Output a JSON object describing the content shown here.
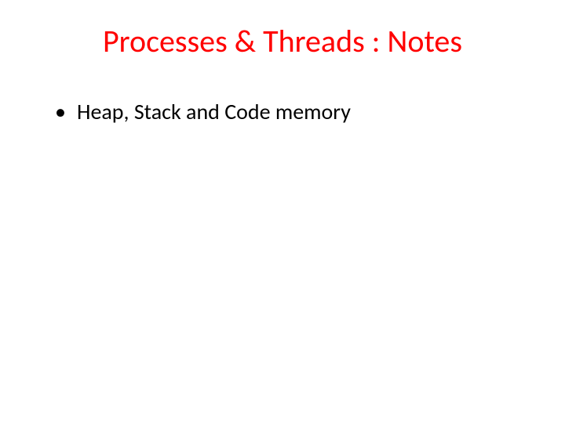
{
  "slide": {
    "title": "Processes & Threads : Notes",
    "bullets": [
      "Heap, Stack and Code memory"
    ]
  }
}
